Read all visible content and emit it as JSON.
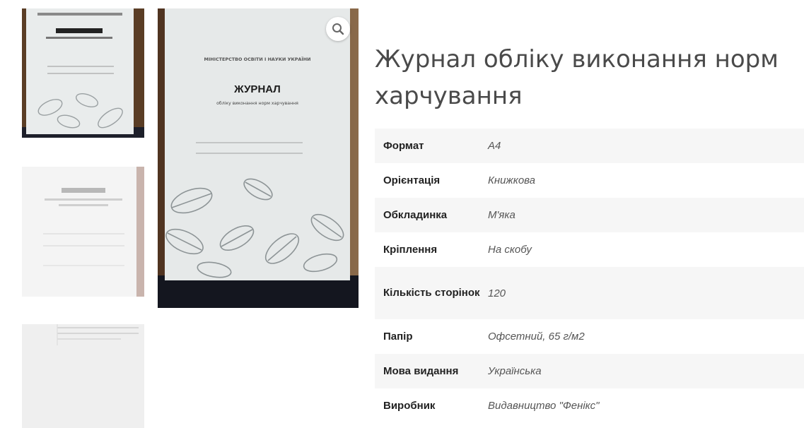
{
  "product": {
    "title": "Журнал обліку виконання норм харчування"
  },
  "gallery": {
    "cover_text": {
      "ministry": "МІНІСТЕРСТВО ОСВІТИ І НАУКИ УКРАЇНИ",
      "journal": "ЖУРНАЛ",
      "subtitle": "обліку виконання норм харчування"
    },
    "zoom_icon": "search-icon"
  },
  "specs": [
    {
      "label": "Формат",
      "value": "А4"
    },
    {
      "label": "Орієнтація",
      "value": "Книжкова"
    },
    {
      "label": "Обкладинка",
      "value": "М'яка"
    },
    {
      "label": "Кріплення",
      "value": "На скобу"
    },
    {
      "label": "Кількість сторінок",
      "value": "120"
    },
    {
      "label": "Папір",
      "value": "Офсетний, 65 г/м2"
    },
    {
      "label": "Мова видання",
      "value": "Українська"
    },
    {
      "label": "Виробник",
      "value": "Видавництво \"Фенікс\""
    }
  ]
}
